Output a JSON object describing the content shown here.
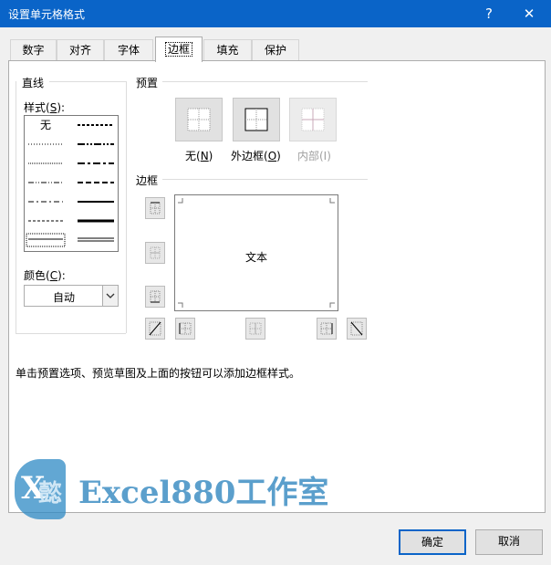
{
  "window": {
    "title": "设置单元格格式",
    "help_label": "?",
    "close_label": "✕"
  },
  "tabs": [
    {
      "label": "数字"
    },
    {
      "label": "对齐"
    },
    {
      "label": "字体"
    },
    {
      "label": "边框",
      "active": true
    },
    {
      "label": "填充"
    },
    {
      "label": "保护"
    }
  ],
  "line": {
    "group_label": "直线",
    "style_label": "样式(S):",
    "style_none_label": "无",
    "color_label": "颜色(C):",
    "color_value": "自动"
  },
  "presets": {
    "group_label": "预置",
    "items": [
      {
        "label": "无(N)",
        "enabled": true
      },
      {
        "label": "外边框(O)",
        "enabled": true
      },
      {
        "label": "内部(I)",
        "enabled": false
      }
    ]
  },
  "border": {
    "group_label": "边框",
    "preview_text": "文本"
  },
  "hint": "单击预置选项、预览草图及上面的按钮可以添加边框样式。",
  "watermark": {
    "text": "Excel880工作室",
    "logo_letter": "X",
    "logo_char": "懿"
  },
  "buttons": {
    "ok": "确定",
    "cancel": "取消"
  },
  "colors": {
    "title_bar": "#0a64c8",
    "ok_border": "#0a64c8",
    "watermark": "#3f8fc4"
  }
}
